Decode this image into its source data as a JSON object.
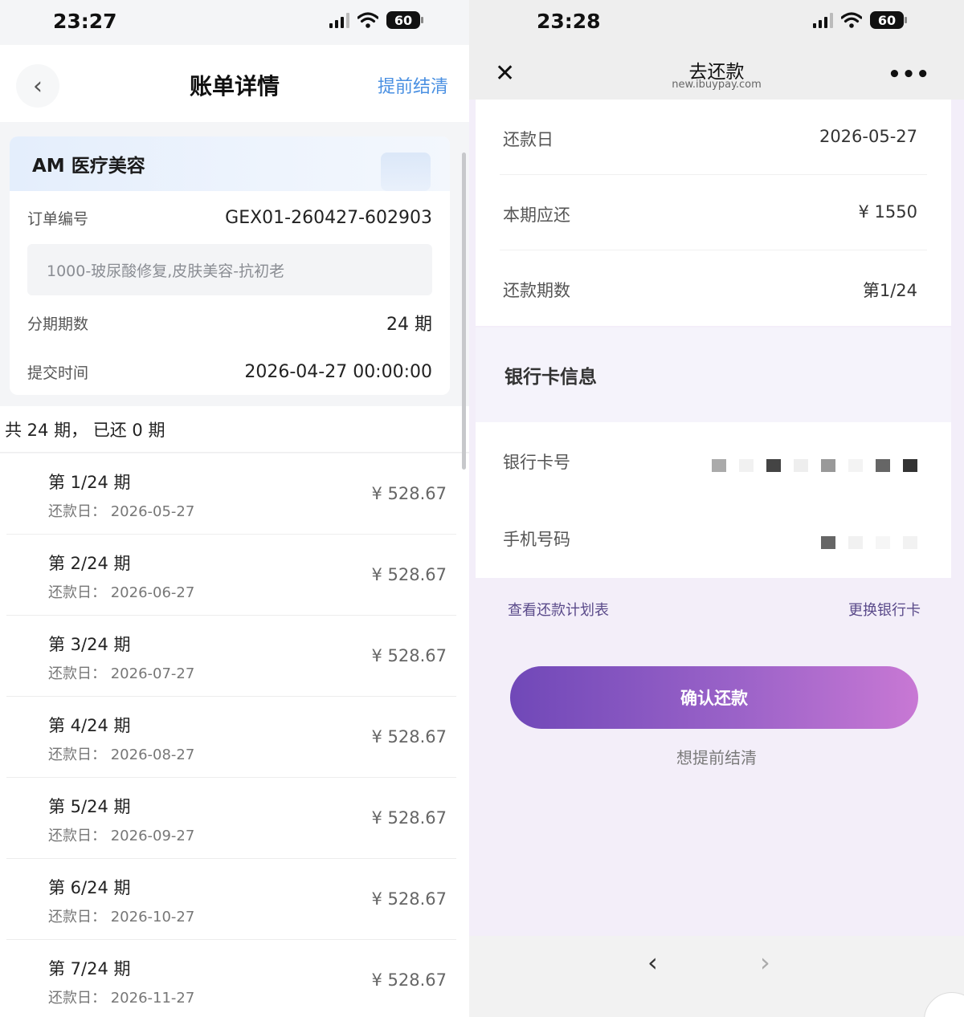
{
  "left": {
    "status": {
      "time": "23:27",
      "battery": "60"
    },
    "nav": {
      "title": "账单详情",
      "early_settle": "提前结清"
    },
    "card": {
      "merchant": "AM 医疗美容",
      "order_label": "订单编号",
      "order_no": "GEX01-260427-602903",
      "description": "1000-玻尿酸修复,皮肤美容-抗初老",
      "installments_label": "分期期数",
      "installments_value": "24 期",
      "submit_label": "提交时间",
      "submit_value": "2026-04-27 00:00:00"
    },
    "summary": "共 24 期， 已还 0 期",
    "periods": [
      {
        "period": "第 1/24 期",
        "date": "还款日： 2026-05-27",
        "amount": "¥ 528.67"
      },
      {
        "period": "第 2/24 期",
        "date": "还款日： 2026-06-27",
        "amount": "¥ 528.67"
      },
      {
        "period": "第 3/24 期",
        "date": "还款日： 2026-07-27",
        "amount": "¥ 528.67"
      },
      {
        "period": "第 4/24 期",
        "date": "还款日： 2026-08-27",
        "amount": "¥ 528.67"
      },
      {
        "period": "第 5/24 期",
        "date": "还款日： 2026-09-27",
        "amount": "¥ 528.67"
      },
      {
        "period": "第 6/24 期",
        "date": "还款日： 2026-10-27",
        "amount": "¥ 528.67"
      },
      {
        "period": "第 7/24 期",
        "date": "还款日： 2026-11-27",
        "amount": "¥ 528.67"
      }
    ]
  },
  "right": {
    "status": {
      "time": "23:28",
      "battery": "60"
    },
    "nav": {
      "title": "去还款",
      "url": "new.ibuypay.com"
    },
    "rows": [
      {
        "label": "还款日",
        "value": "2026-05-27"
      },
      {
        "label": "本期应还",
        "value": "¥ 1550"
      },
      {
        "label": "还款期数",
        "value": "第1/24"
      }
    ],
    "bank": {
      "heading": "银行卡信息",
      "card_label": "银行卡号",
      "phone_label": "手机号码"
    },
    "links": {
      "schedule": "查看还款计划表",
      "change_card": "更换银行卡"
    },
    "confirm": "确认还款",
    "early": "想提前结清"
  },
  "colors": {
    "accent_blue": "#4a90e2",
    "purple_start": "#7048b8",
    "purple_end": "#c878d4"
  }
}
